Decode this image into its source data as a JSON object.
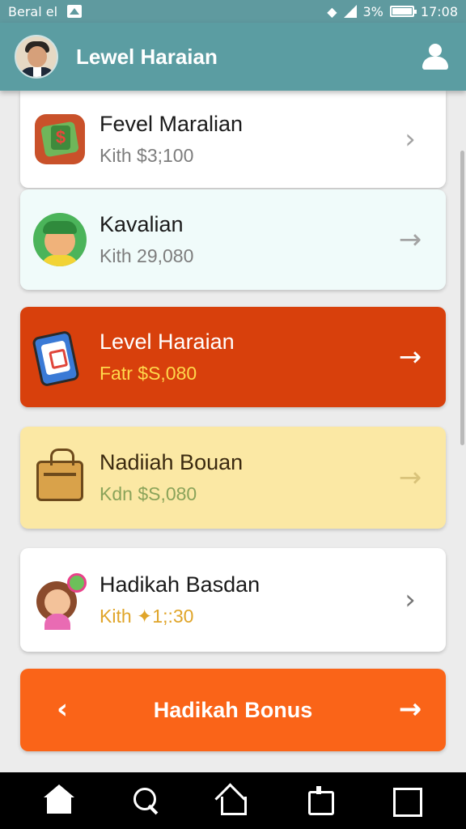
{
  "status_bar": {
    "carrier": "Beral el",
    "battery_percent": "3%",
    "time": "17:08"
  },
  "header": {
    "title": "Lewel Haraian"
  },
  "items": [
    {
      "title": "Fevel  Maralian",
      "subtitle": "Kith $3;100"
    },
    {
      "title": "Kavalian",
      "subtitle": "Kith 29,080"
    },
    {
      "title": "Level Haraian",
      "subtitle": "Fatr $S,080"
    },
    {
      "title": "Nadiiah Bouan",
      "subtitle": "Kdn $S,080"
    },
    {
      "title": "Hadikah Basdan",
      "subtitle": "Kith ✦1;:30"
    }
  ],
  "bonus": {
    "label": "Hadikah Bonus"
  },
  "colors": {
    "header_bg": "#5b9da2",
    "accent_red": "#d8400c",
    "accent_orange": "#fa6418",
    "card_yellow": "#fbe8a4",
    "card_mint": "#f0fbfa"
  },
  "icons": {
    "item_icons": [
      "money-icon",
      "boy-avatar-icon",
      "phone-icon",
      "bag-icon",
      "girl-avatar-icon"
    ],
    "nav": [
      "home-icon",
      "search-icon",
      "home-outline-icon",
      "recent-apps-icon",
      "overview-icon"
    ]
  }
}
